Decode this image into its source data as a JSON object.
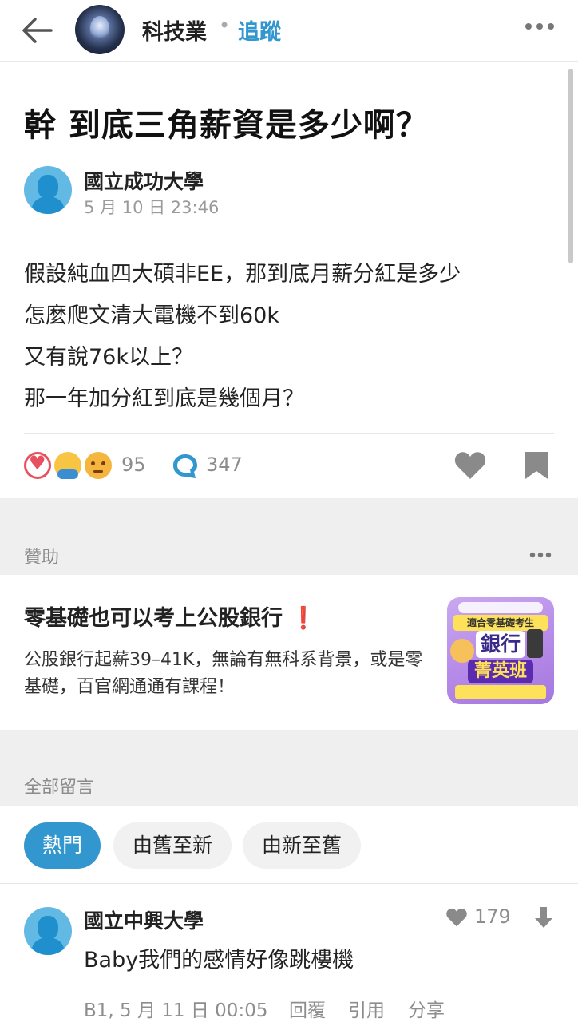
{
  "header": {
    "board_name": "科技業",
    "separator": "•",
    "follow_label": "追蹤"
  },
  "post": {
    "title": "幹 到底三角薪資是多少啊？",
    "author": "國立成功大學",
    "time": "5 月 10 日 23:46",
    "body_lines": [
      "假設純血四大碩非EE，那到底月薪分紅是多少",
      "怎麼爬文清大電機不到60k",
      "又有說76k以上？",
      "那一年加分紅到底是幾個月？"
    ],
    "reaction_count": "95",
    "comment_count": "347"
  },
  "sponsor": {
    "section_label": "贊助",
    "title": "零基礎也可以考上公股銀行",
    "title_mark": "❗",
    "desc": "公股銀行起薪39–41K，無論有無科系背景，或是零基礎，百官網通通有課程！",
    "ad_band": "適合零基礎考生",
    "ad_bank": "銀行",
    "ad_elite": "菁英班"
  },
  "comments_section": {
    "label": "全部留言",
    "sort_options": [
      "熱門",
      "由舊至新",
      "由新至舊"
    ]
  },
  "comments": [
    {
      "author": "國立中興大學",
      "likes": "179",
      "text": "Baby我們的感情好像跳樓機",
      "floor_time": "B1, 5 月 11 日 00:05",
      "reply": "回覆",
      "quote": "引用",
      "share": "分享"
    }
  ],
  "colors": {
    "accent": "#3397cf",
    "text": "#222222",
    "muted": "#8d8d8d",
    "band": "#efefef",
    "alert": "#e0262d"
  }
}
